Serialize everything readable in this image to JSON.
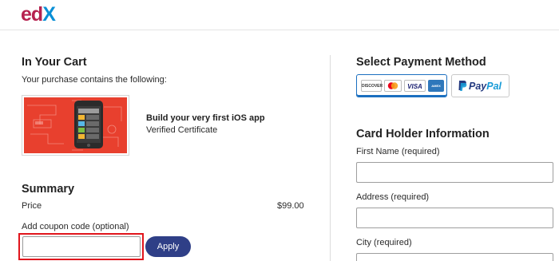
{
  "header": {
    "logo_text": {
      "e": "e",
      "d": "d",
      "x": "X"
    }
  },
  "cart": {
    "title": "In Your Cart",
    "subtitle": "Your purchase contains the following:",
    "course": {
      "title": "Build your very first iOS app",
      "type": "Verified Certificate"
    }
  },
  "summary": {
    "title": "Summary",
    "price_label": "Price",
    "price_value": "$99.00",
    "coupon_label": "Add coupon code (optional)",
    "coupon_value": "",
    "coupon_placeholder": "",
    "apply_label": "Apply"
  },
  "payment": {
    "title": "Select Payment Method",
    "cards": {
      "discover": "DISCOVER",
      "visa": "VISA",
      "amex": "AMEX"
    },
    "paypal": {
      "pay": "Pay",
      "pal": "Pal"
    }
  },
  "card_holder": {
    "title": "Card Holder Information",
    "first_name_label": "First Name (required)",
    "address_label": "Address (required)",
    "city_label": "City (required)"
  },
  "colors": {
    "edx_red": "#b6224f",
    "edx_blue": "#0a8fd6",
    "apply_button": "#2f3f87",
    "highlight_border": "#e1151c",
    "payment_selected": "#1b6fc0",
    "course_bg": "#e8402e"
  }
}
